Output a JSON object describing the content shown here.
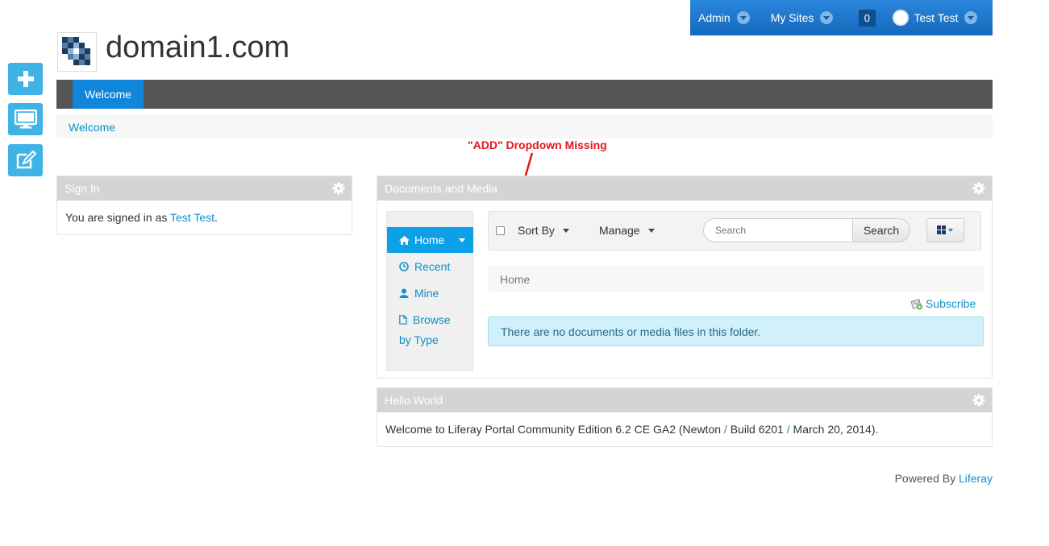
{
  "dockbar": {
    "admin_label": "Admin",
    "my_sites_label": "My Sites",
    "notification_count": "0",
    "user_label": "Test Test"
  },
  "site": {
    "name": "domain1.com"
  },
  "side_buttons": [
    "add-icon",
    "preview-icon",
    "edit-icon"
  ],
  "nav": {
    "tabs": [
      {
        "label": "Welcome"
      }
    ]
  },
  "breadcrumb": {
    "items": [
      "Welcome"
    ]
  },
  "annotation": {
    "text": "\"ADD\" Dropdown Missing",
    "color": "#e3161b"
  },
  "signin_portlet": {
    "title": "Sign In",
    "text_prefix": "You are signed in as ",
    "user_link": "Test Test",
    "text_suffix": "."
  },
  "docs_portlet": {
    "title": "Documents and Media",
    "nav": {
      "home": "Home",
      "recent": "Recent",
      "mine": "Mine",
      "browse_line1": "Browse",
      "browse_line2": "by Type"
    },
    "toolbar": {
      "sort_by": "Sort By",
      "manage": "Manage",
      "search_placeholder": "Search",
      "search_button": "Search"
    },
    "breadcrumb": "Home",
    "subscribe": "Subscribe",
    "empty_message": "There are no documents or media files in this folder."
  },
  "hello_portlet": {
    "title": "Hello World",
    "text_prefix": "Welcome to Liferay Portal Community Edition 6.2 CE GA2 (Newton",
    "sep1": " / ",
    "build": "Build 6201",
    "sep2": " / ",
    "date": "March 20, 2014).",
    "full_text": "Welcome to Liferay Portal Community Edition 6.2 CE GA2 (Newton / Build 6201 / March 20, 2014)."
  },
  "footer": {
    "prefix": "Powered By ",
    "link": "Liferay"
  },
  "colors": {
    "dockbar": "#1a73c9",
    "accent": "#0b90c9",
    "nav_bg": "#555555",
    "nav_active": "#0f86d9",
    "side_button": "#3fb3e6",
    "info_bg": "#d0f0fb"
  }
}
